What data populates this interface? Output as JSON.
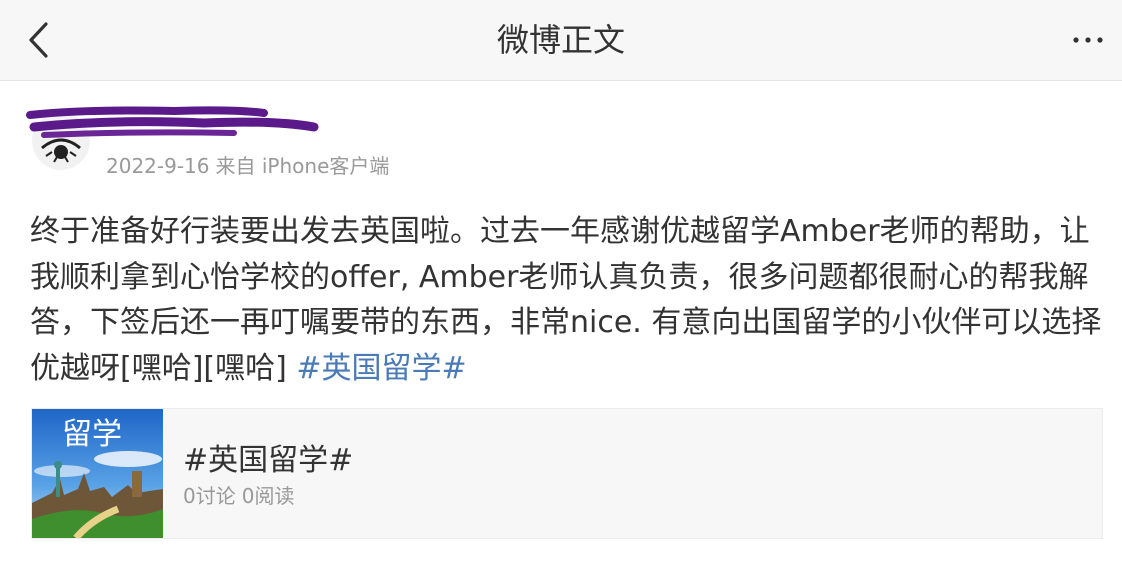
{
  "nav": {
    "back_icon": "chevron-left-icon",
    "title": "微博正文",
    "more_icon": "more-horizontal-icon"
  },
  "post": {
    "avatar_icon": "avatar",
    "date": "2022-9-16",
    "source": "来自 iPhone客户端",
    "text": "终于准备好行装要出发去英国啦。过去一年感谢优越留学Amber老师的帮助，让我顺利拿到心怡学校的offer, Amber老师认真负责，很多问题都很耐心的帮我解答，下签后还一再叮嘱要带的东西，非常nice. 有意向出国留学的小伙伴可以选择优越呀[嘿哈][嘿哈] ",
    "topic": "#英国留学#"
  },
  "topic_card": {
    "thumbnail_text": "留学",
    "title": "#英国留学#",
    "discussions": "0讨论",
    "reads": "0阅读"
  },
  "colors": {
    "nav_background": "#f7f7f7",
    "link": "#4a7bb7",
    "meta_text": "#999999",
    "body_text": "#333333",
    "redaction": "#5b1a8a"
  }
}
